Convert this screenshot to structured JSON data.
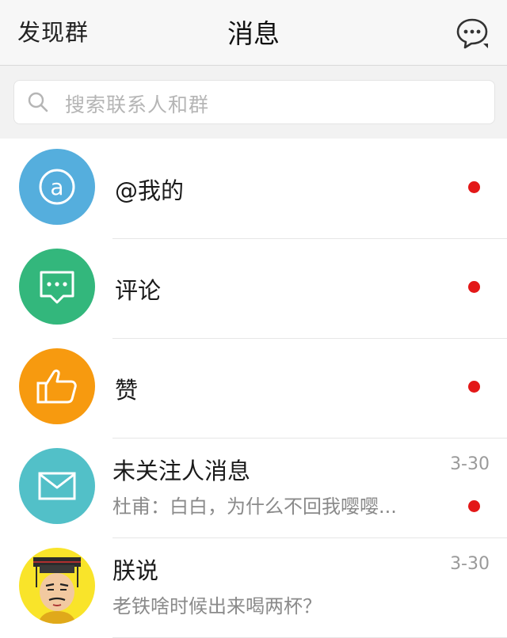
{
  "nav": {
    "left_label": "发现群",
    "title": "消息"
  },
  "search": {
    "placeholder": "搜索联系人和群"
  },
  "colors": {
    "at_mine": "#55aedd",
    "comment": "#33b77c",
    "like": "#f79a0f",
    "stranger": "#52c0c8",
    "unread_dot": "#e31818"
  },
  "rows": [
    {
      "title": "@我的",
      "icon": "at-icon",
      "unread": true
    },
    {
      "title": "评论",
      "icon": "comment-bubble-icon",
      "unread": true
    },
    {
      "title": "赞",
      "icon": "thumbs-up-icon",
      "unread": true
    },
    {
      "title": "未关注人消息",
      "subtitle": "杜甫：白白，为什么不回我嘤嘤...",
      "time": "3-30",
      "icon": "envelope-icon",
      "unread": true
    },
    {
      "title": "朕说",
      "subtitle": "老铁啥时候出来喝两杯？",
      "time": "3-30",
      "icon": "emperor-avatar",
      "unread": false
    }
  ]
}
